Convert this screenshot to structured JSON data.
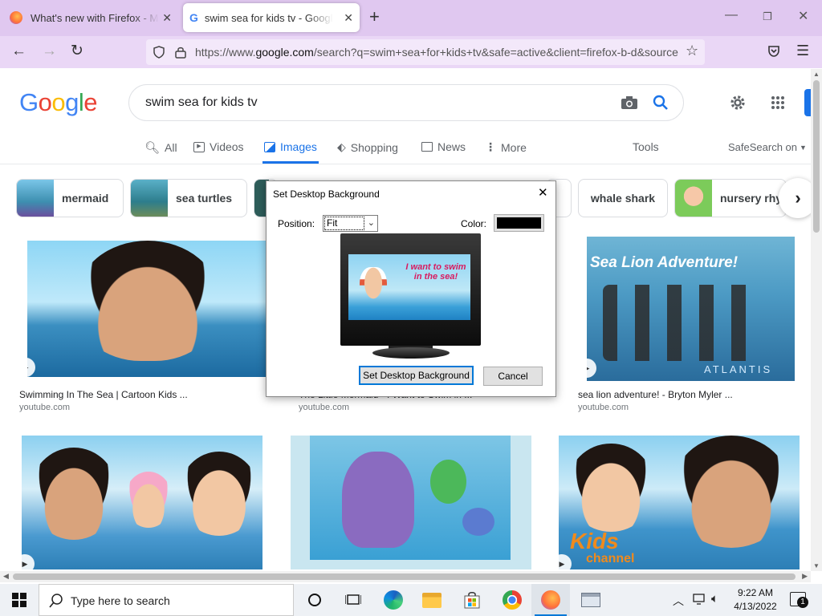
{
  "browser": {
    "tabs": [
      {
        "title": "What's new with Firefox - More"
      },
      {
        "title": "swim sea for kids tv - Google Sea"
      }
    ],
    "url_prefix": "https://www.",
    "url_domain": "google.com",
    "url_rest": "/search?q=swim+sea+for+kids+tv&safe=active&client=firefox-b-d&source"
  },
  "google": {
    "logo_letters": [
      "G",
      "o",
      "o",
      "g",
      "l",
      "e"
    ],
    "logo_colors": [
      "#4285f4",
      "#ea4335",
      "#fbbc05",
      "#4285f4",
      "#34a853",
      "#ea4335"
    ],
    "query": "swim sea for kids tv",
    "nav": {
      "all": "All",
      "videos": "Videos",
      "images": "Images",
      "shopping": "Shopping",
      "news": "News",
      "more": "More",
      "tools": "Tools",
      "safesearch": "SafeSearch on"
    },
    "chips": [
      "mermaid",
      "sea turtles",
      "",
      "",
      "whale shark",
      "nursery rhy"
    ],
    "results": [
      {
        "caption": "Swimming In The Sea | Cartoon Kids ...",
        "source": "youtube.com"
      },
      {
        "caption": "The Little Mermaid - I Want to Swim in ...",
        "source": "youtube.com"
      },
      {
        "caption": "sea lion adventure! - Bryton Myler ...",
        "source": "youtube.com"
      }
    ],
    "thumb_text": {
      "sea_lion": "Sea Lion Adventure!",
      "atlantis": "ATLANTIS",
      "kids": "Kids",
      "channel": "channel"
    }
  },
  "dialog": {
    "title": "Set Desktop Background",
    "position_label": "Position:",
    "position_value": "Fit",
    "color_label": "Color:",
    "color_value": "#000000",
    "preview_text": "I want to swim in the sea!",
    "ok_label": "Set Desktop Background",
    "cancel_label": "Cancel"
  },
  "taskbar": {
    "search_placeholder": "Type here to search",
    "time": "9:22 AM",
    "date": "4/13/2022",
    "notification_count": "1"
  },
  "colors": {
    "tabstrip": "#e0c8f0",
    "navbar": "#ead7f6",
    "accent": "#1a73e8",
    "taskbar": "#eef1f5"
  }
}
